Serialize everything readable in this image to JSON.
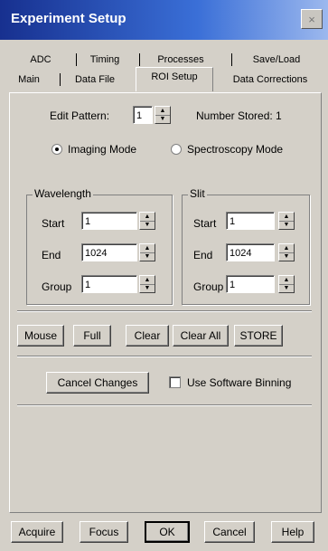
{
  "window": {
    "title": "Experiment Setup",
    "close_glyph": "×"
  },
  "tabs": {
    "row1": [
      "ADC",
      "Timing",
      "Processes",
      "Save/Load"
    ],
    "row2": [
      "Main",
      "Data File",
      "ROI Setup",
      "Data Corrections"
    ],
    "active": "ROI Setup"
  },
  "edit_pattern": {
    "label": "Edit Pattern:",
    "value": "1",
    "number_stored": "Number Stored: 1"
  },
  "mode": {
    "imaging_label": "Imaging Mode",
    "spectroscopy_label": "Spectroscopy Mode",
    "selected": "Imaging Mode"
  },
  "wavelength": {
    "title": "Wavelength",
    "start_label": "Start",
    "start_value": "1",
    "end_label": "End",
    "end_value": "1024",
    "group_label": "Group",
    "group_value": "1"
  },
  "slit": {
    "title": "Slit",
    "start_label": "Start",
    "start_value": "1",
    "end_label": "End",
    "end_value": "1024",
    "group_label": "Group",
    "group_value": "1"
  },
  "action_buttons": {
    "mouse": "Mouse",
    "full": "Full",
    "clear": "Clear",
    "clear_all": "Clear All",
    "store": "STORE"
  },
  "cancel_changes": "Cancel Changes",
  "software_binning": {
    "label": "Use Software Binning",
    "checked": false
  },
  "footer": {
    "acquire": "Acquire",
    "focus": "Focus",
    "ok": "OK",
    "cancel": "Cancel",
    "help": "Help"
  },
  "icons": {
    "close": "close-icon",
    "spin_up": "▲",
    "spin_down": "▼"
  },
  "colors": {
    "titlebar_start": "#17308f",
    "titlebar_end": "#9cb8ee",
    "face": "#d4d0c8"
  }
}
